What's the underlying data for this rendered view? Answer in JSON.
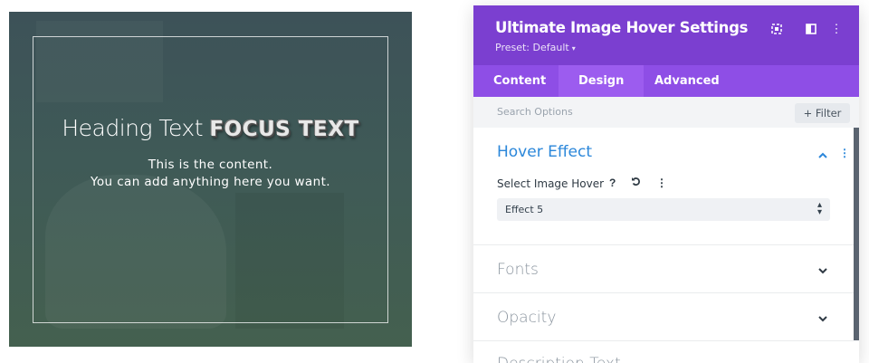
{
  "preview": {
    "heading_plain": "Heading Text ",
    "heading_focus": "FOCUS TEXT",
    "content_line1": "This is the content.",
    "content_line2": "You can add anything here you want."
  },
  "panel": {
    "title": "Ultimate Image Hover Settings",
    "preset": "Preset: Default",
    "header_icons": [
      "expand-icon",
      "columns-icon",
      "more-vertical-icon"
    ],
    "accent_color": "#7b3fd0",
    "tabs": [
      {
        "label": "Content"
      },
      {
        "label": "Design"
      },
      {
        "label": "Advanced"
      }
    ],
    "active_tab": "Design",
    "search": {
      "placeholder": "Search Options",
      "filter_label": "+ Filter"
    },
    "sections": [
      {
        "title": "Hover Effect",
        "expanded": true
      },
      {
        "title": "Fonts",
        "expanded": false
      },
      {
        "title": "Opacity",
        "expanded": false
      },
      {
        "title": "Description Text",
        "expanded": false
      }
    ],
    "hover_effect": {
      "field_label": "Select Image Hover",
      "selected_value": "Effect 5"
    }
  }
}
